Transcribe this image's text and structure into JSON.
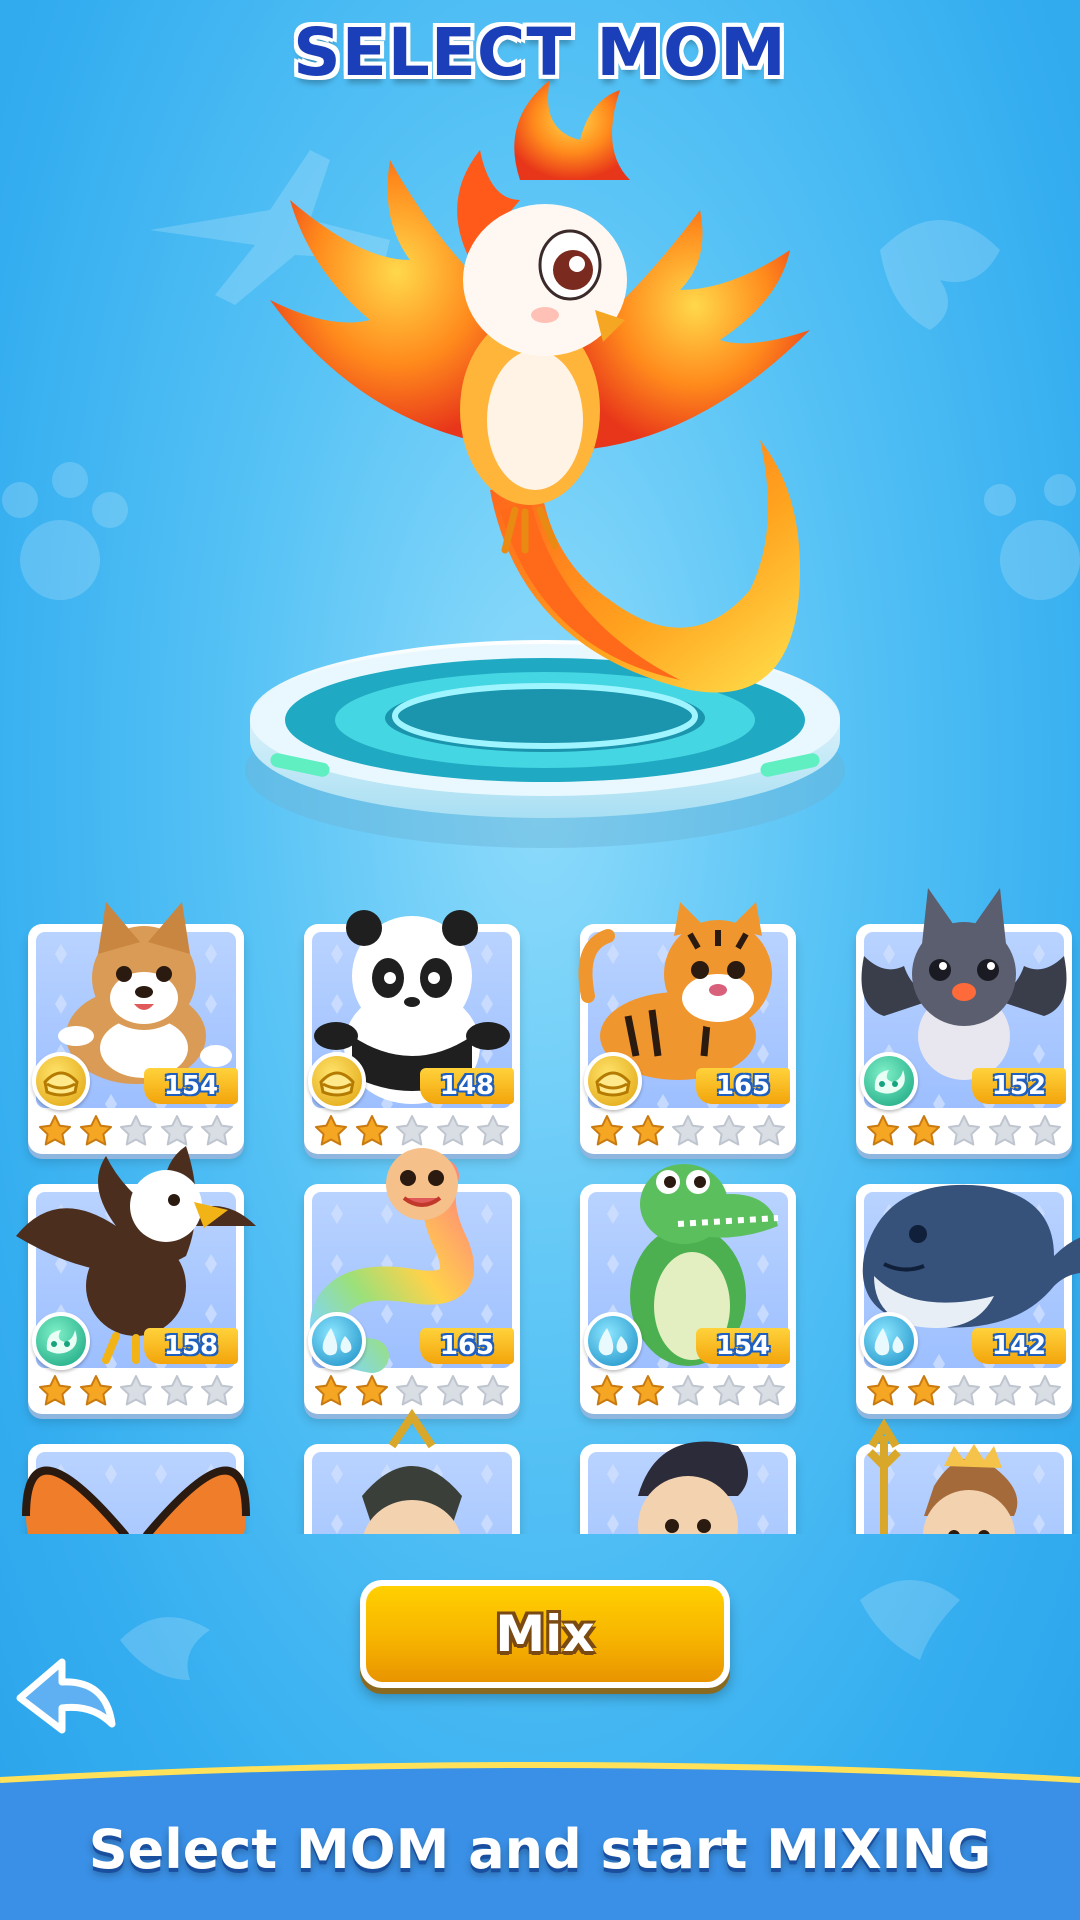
{
  "header": {
    "title": "SELECT MOM"
  },
  "hero": {
    "creature": "phoenix",
    "icon": "phoenix-illustration"
  },
  "cards": [
    {
      "creature": "corgi",
      "power": "154",
      "element": "gold",
      "stars": 2
    },
    {
      "creature": "panda",
      "power": "148",
      "element": "gold",
      "stars": 2
    },
    {
      "creature": "tiger",
      "power": "165",
      "element": "gold",
      "stars": 2
    },
    {
      "creature": "bat",
      "power": "152",
      "element": "teal",
      "stars": 2
    },
    {
      "creature": "eagle",
      "power": "158",
      "element": "teal",
      "stars": 2
    },
    {
      "creature": "snake",
      "power": "165",
      "element": "water",
      "stars": 2
    },
    {
      "creature": "crocodile",
      "power": "154",
      "element": "water",
      "stars": 2
    },
    {
      "creature": "whale",
      "power": "142",
      "element": "water",
      "stars": 2
    },
    {
      "creature": "butterfly",
      "power": "",
      "element": "",
      "stars": 0
    },
    {
      "creature": "samurai",
      "power": "",
      "element": "",
      "stars": 0
    },
    {
      "creature": "superhero",
      "power": "",
      "element": "",
      "stars": 0
    },
    {
      "creature": "poseidon",
      "power": "",
      "element": "",
      "stars": 0
    }
  ],
  "stars_total": 5,
  "mix_button": {
    "label": "Mix"
  },
  "back_button": {
    "icon": "back-arrow-icon"
  },
  "footer": {
    "text": "Select MOM and start MIXING"
  },
  "colors": {
    "background": "#3fb5f2",
    "title": "#1a3fb8",
    "mix_button": "#f7b400",
    "power_badge": "#f3a40b",
    "star_filled": "#f5a623",
    "star_empty": "#d9dde4"
  }
}
